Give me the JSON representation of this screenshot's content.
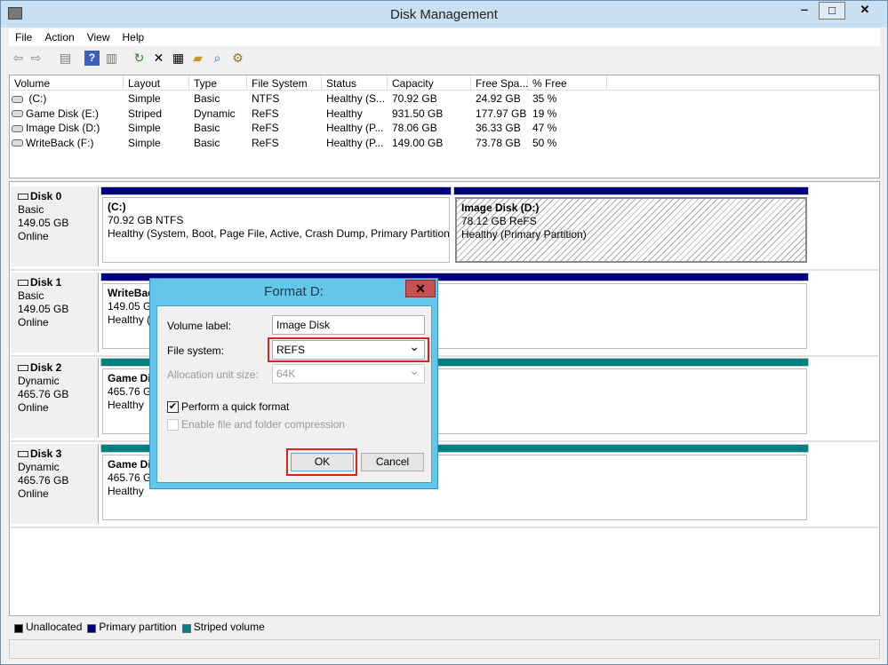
{
  "window": {
    "title": "Disk Management"
  },
  "menu": [
    "File",
    "Action",
    "View",
    "Help"
  ],
  "toolbar_icons": [
    "back-icon",
    "forward-icon",
    "console-tree-icon",
    "help-icon",
    "action-pane-icon",
    "refresh-icon",
    "delete-icon",
    "properties-icon",
    "open-icon",
    "search-icon",
    "settings-icon"
  ],
  "volume_list": {
    "headers": [
      "Volume",
      "Layout",
      "Type",
      "File System",
      "Status",
      "Capacity",
      "Free Spa...",
      "% Free"
    ],
    "rows": [
      [
        " (C:)",
        "Simple",
        "Basic",
        "NTFS",
        "Healthy (S...",
        "70.92 GB",
        "24.92 GB",
        "35 %"
      ],
      [
        "Game Disk (E:)",
        "Striped",
        "Dynamic",
        "ReFS",
        "Healthy",
        "931.50 GB",
        "177.97 GB",
        "19 %"
      ],
      [
        "Image Disk (D:)",
        "Simple",
        "Basic",
        "ReFS",
        "Healthy (P...",
        "78.06 GB",
        "36.33 GB",
        "47 %"
      ],
      [
        "WriteBack (F:)",
        "Simple",
        "Basic",
        "ReFS",
        "Healthy (P...",
        "149.00 GB",
        "73.78 GB",
        "50 %"
      ]
    ]
  },
  "disks": [
    {
      "name": "Disk 0",
      "type": "Basic",
      "size": "149.05 GB",
      "state": "Online",
      "partitions": [
        {
          "name": "(C:)",
          "info": "70.92 GB NTFS",
          "status": "Healthy (System, Boot, Page File, Active, Crash Dump, Primary Partition)"
        },
        {
          "name": "Image Disk  (D:)",
          "info": "78.12 GB ReFS",
          "status": "Healthy (Primary Partition)"
        }
      ]
    },
    {
      "name": "Disk 1",
      "type": "Basic",
      "size": "149.05 GB",
      "state": "Online",
      "partitions": [
        {
          "name": "WriteBac",
          "info": "149.05 GB",
          "status": "Healthy ("
        }
      ]
    },
    {
      "name": "Disk 2",
      "type": "Dynamic",
      "size": "465.76 GB",
      "state": "Online",
      "partitions": [
        {
          "name": "Game Dis",
          "info": "465.76 GB",
          "status": "Healthy"
        }
      ]
    },
    {
      "name": "Disk 3",
      "type": "Dynamic",
      "size": "465.76 GB",
      "state": "Online",
      "partitions": [
        {
          "name": "Game Dis",
          "info": "465.76 GB",
          "status": "Healthy"
        }
      ]
    }
  ],
  "legend": [
    {
      "label": "Unallocated",
      "color": "#000000"
    },
    {
      "label": "Primary partition",
      "color": "#00007f"
    },
    {
      "label": "Striped volume",
      "color": "#008080"
    }
  ],
  "dialog": {
    "title": "Format D:",
    "volume_label_label": "Volume label:",
    "volume_label_value": "Image Disk",
    "fs_label": "File system:",
    "fs_value": "REFS",
    "alloc_label": "Allocation unit size:",
    "alloc_value": "64K",
    "quick_format": "Perform a quick format",
    "quick_format_checked": true,
    "compression": "Enable file and folder compression",
    "compression_checked": false,
    "ok": "OK",
    "cancel": "Cancel",
    "highlight_color": "#e02020"
  }
}
